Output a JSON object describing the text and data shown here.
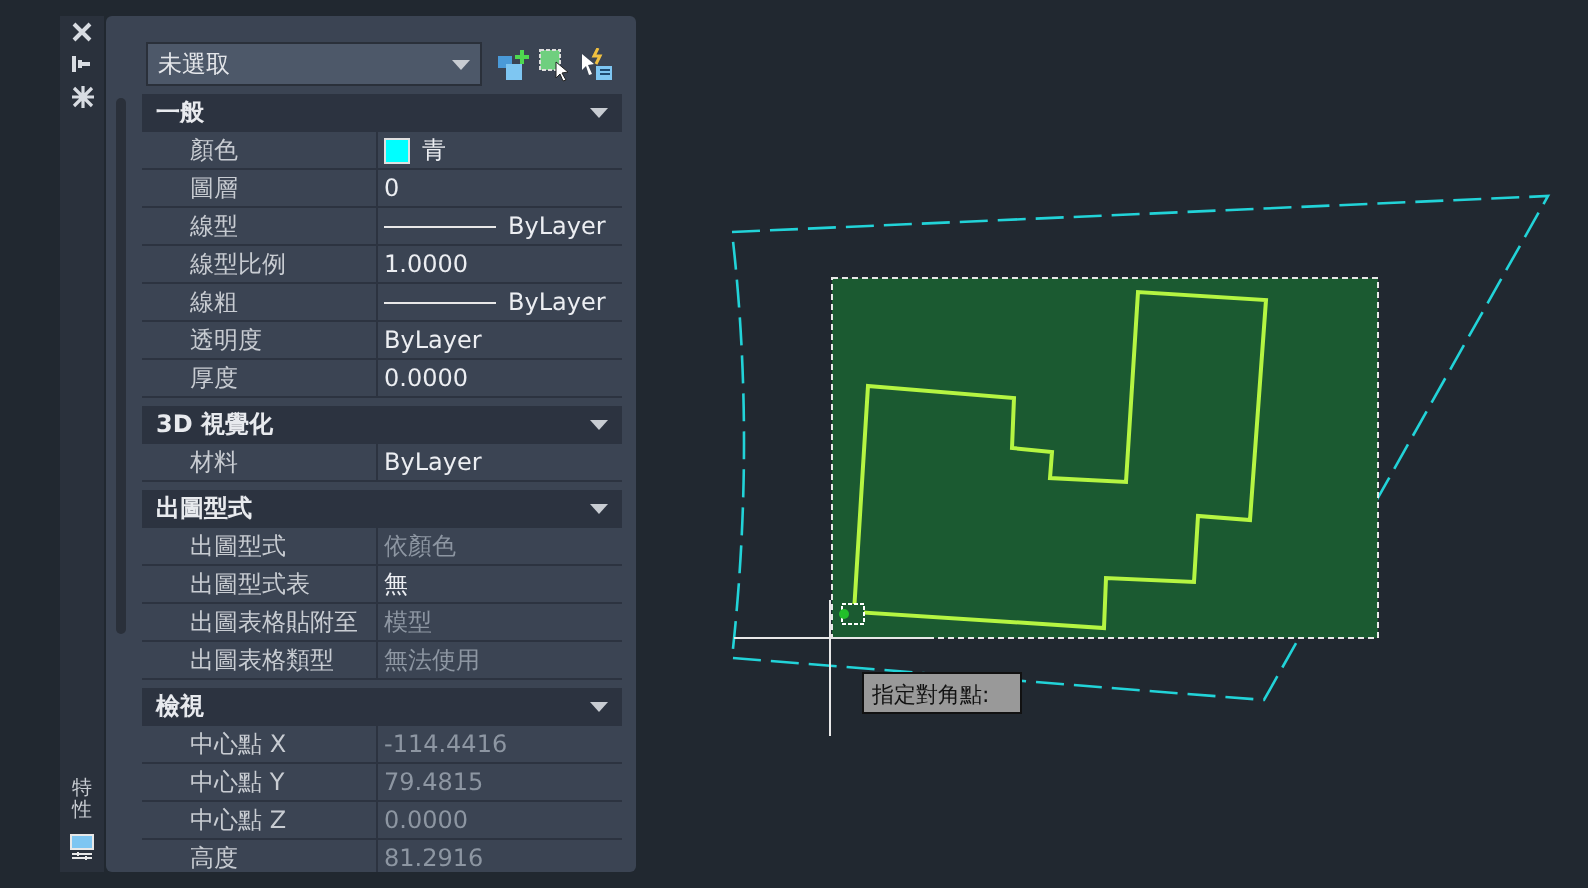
{
  "side_tab": {
    "label": "特性"
  },
  "panel": {
    "selection": {
      "value": "未選取"
    },
    "sections": [
      {
        "title": "一般",
        "expanded": true,
        "rows": [
          {
            "label": "顏色",
            "kind": "color",
            "value": "青",
            "color": "#00ffff",
            "disabled": false
          },
          {
            "label": "圖層",
            "kind": "text",
            "value": "0",
            "disabled": false
          },
          {
            "label": "線型",
            "kind": "linetype",
            "value": "ByLayer",
            "disabled": false
          },
          {
            "label": "線型比例",
            "kind": "text",
            "value": "1.0000",
            "disabled": false
          },
          {
            "label": "線粗",
            "kind": "linetype",
            "value": "ByLayer",
            "disabled": false
          },
          {
            "label": "透明度",
            "kind": "text",
            "value": "ByLayer",
            "disabled": false
          },
          {
            "label": "厚度",
            "kind": "text",
            "value": "0.0000",
            "disabled": false
          }
        ]
      },
      {
        "title": "3D 視覺化",
        "expanded": true,
        "rows": [
          {
            "label": "材料",
            "kind": "text",
            "value": "ByLayer",
            "disabled": false
          }
        ]
      },
      {
        "title": "出圖型式",
        "expanded": true,
        "rows": [
          {
            "label": "出圖型式",
            "kind": "text",
            "value": "依顏色",
            "disabled": true
          },
          {
            "label": "出圖型式表",
            "kind": "text",
            "value": "無",
            "disabled": false
          },
          {
            "label": "出圖表格貼附至",
            "kind": "text",
            "value": "模型",
            "disabled": true
          },
          {
            "label": "出圖表格類型",
            "kind": "text",
            "value": "無法使用",
            "disabled": true
          }
        ]
      },
      {
        "title": "檢視",
        "expanded": true,
        "rows": [
          {
            "label": "中心點 X",
            "kind": "text",
            "value": "-114.4416",
            "disabled": true
          },
          {
            "label": "中心點 Y",
            "kind": "text",
            "value": "79.4815",
            "disabled": true
          },
          {
            "label": "中心點 Z",
            "kind": "text",
            "value": "0.0000",
            "disabled": true
          },
          {
            "label": "高度",
            "kind": "text",
            "value": "81.2916",
            "disabled": true
          }
        ]
      }
    ]
  },
  "canvas": {
    "prompt": "指定對角點:"
  }
}
